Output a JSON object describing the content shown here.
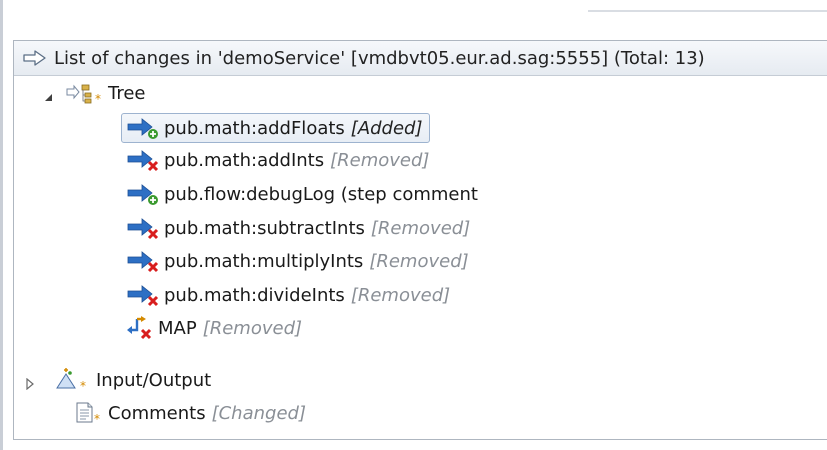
{
  "header": {
    "title": "List of changes in 'demoService' [vmdbvt05.eur.ad.sag:5555] (Total: 13)"
  },
  "tree": {
    "root": {
      "label": "Tree",
      "expanded": true
    },
    "children": [
      {
        "label": "pub.math:addFloats",
        "status": "[Added]",
        "change": "added",
        "selected": true
      },
      {
        "label": "pub.math:addInts",
        "status": "[Removed]",
        "change": "removed"
      },
      {
        "label": "pub.flow:debugLog (step comment",
        "status": "",
        "change": "added"
      },
      {
        "label": "pub.math:subtractInts",
        "status": "[Removed]",
        "change": "removed"
      },
      {
        "label": "pub.math:multiplyInts",
        "status": "[Removed]",
        "change": "removed"
      },
      {
        "label": "pub.math:divideInts",
        "status": "[Removed]",
        "change": "removed"
      },
      {
        "label": "MAP",
        "status": "[Removed]",
        "change": "removed"
      }
    ],
    "siblings": [
      {
        "label": "Input/Output",
        "expanded": false
      },
      {
        "label": "Comments",
        "status": "[Changed]"
      }
    ]
  },
  "colors": {
    "added": "#3a9a2f",
    "removed": "#d81e1e",
    "arrow": "#2d6fc4",
    "status_gray": "#8a8f96",
    "selection_border": "#9db3cf"
  }
}
